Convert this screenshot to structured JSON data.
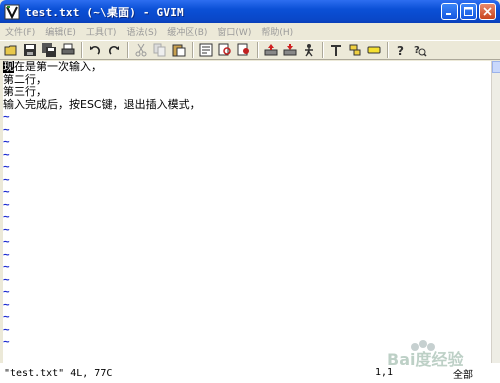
{
  "window": {
    "title": "test.txt (~\\桌面) - GVIM",
    "app_icon": "vim-icon",
    "controls": [
      "minimize-icon",
      "maximize-icon",
      "close-icon"
    ]
  },
  "menubar": {
    "items": [
      "文件(F)",
      "编辑(E)",
      "工具(T)",
      "语法(S)",
      "缓冲区(B)",
      "窗口(W)",
      "帮助(H)"
    ]
  },
  "toolbar": {
    "icons": [
      "open-icon",
      "save-icon",
      "save-all-icon",
      "print-icon",
      "undo-icon",
      "redo-icon",
      "cut-icon",
      "copy-icon",
      "paste-icon",
      "replace-icon",
      "find-next-icon",
      "find-prev-icon",
      "load-session-icon",
      "save-session-icon",
      "run-script-icon",
      "make-icon",
      "shell-icon",
      "tags-icon",
      "help-icon",
      "find-help-icon"
    ]
  },
  "editor": {
    "lines": [
      "现在是第一次输入，",
      "第二行，",
      "第三行，",
      "输入完成后，按ESC键，退出插入模式，"
    ],
    "cursor_char": "现",
    "tilde": "~",
    "tilde_count": 19
  },
  "statusline": {
    "message": "\"test.txt\" 4L, 77C",
    "position": "1,1",
    "scroll": "全部"
  },
  "watermark": {
    "text": "Bai度经验"
  }
}
